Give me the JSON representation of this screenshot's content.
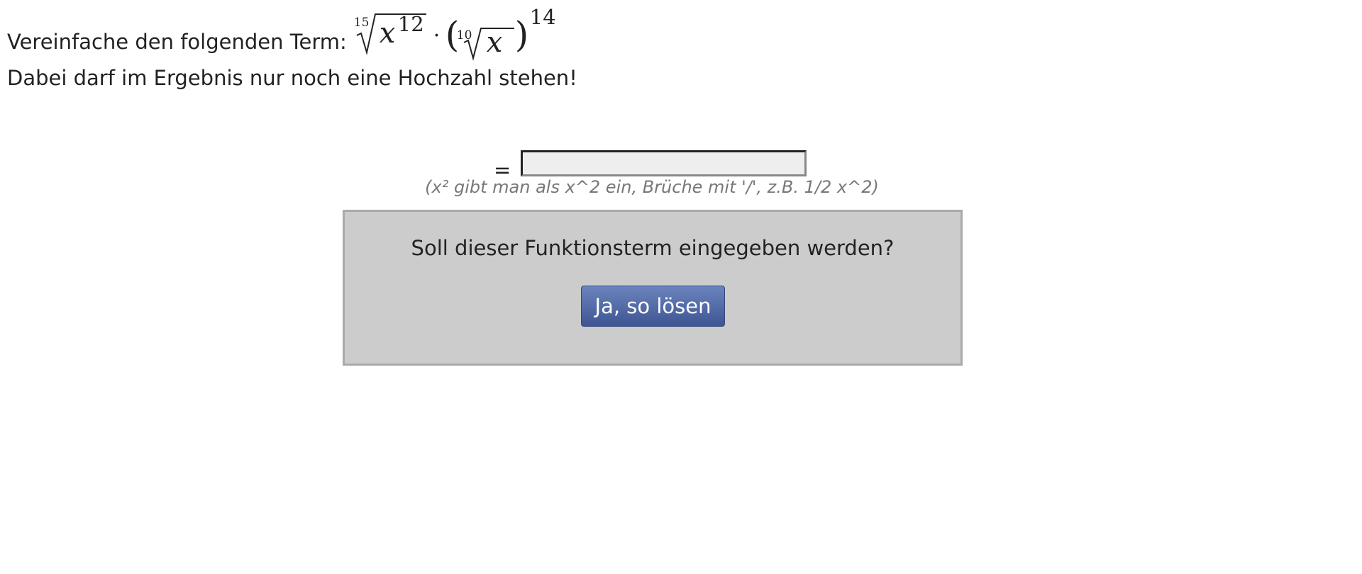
{
  "task": {
    "prefix": "Vereinfache den folgenden Term:",
    "math": {
      "root1_index": "15",
      "root1_radicand_var": "x",
      "root1_radicand_exp": "12",
      "operator": "·",
      "root2_index": "10",
      "root2_radicand_var": "x",
      "outer_exp": "14",
      "paren_open": "(",
      "paren_close": ")"
    },
    "instruction": "Dabei darf im Ergebnis nur noch eine Hochzahl stehen!"
  },
  "answer": {
    "equals": "=",
    "value": "",
    "placeholder": "",
    "hint": "(x² gibt man als x^2 ein, Brüche mit '/', z.B. 1/2 x^2)"
  },
  "confirm": {
    "question": "Soll dieser Funktionsterm eingegeben werden?",
    "button_label": "Ja, so lösen"
  },
  "colors": {
    "button_top": "#6b84bd",
    "button_bottom": "#3e5593",
    "box_background": "#cccccc",
    "box_border": "#aaaaaa",
    "hint_text": "#777777",
    "input_background": "#eeeeee"
  }
}
